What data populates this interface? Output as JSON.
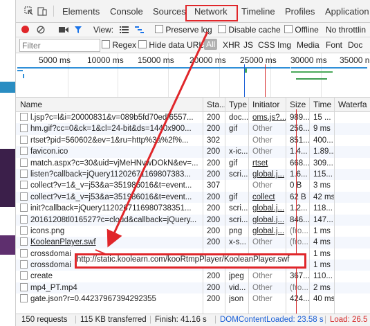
{
  "tabs": [
    "Elements",
    "Console",
    "Sources",
    "Network",
    "Timeline",
    "Profiles",
    "Application"
  ],
  "active_tab": "Network",
  "toolbar": {
    "view_label": "View:",
    "preserve_log": "Preserve log",
    "disable_cache": "Disable cache",
    "offline": "Offline",
    "throttling": "No throttlin"
  },
  "filter": {
    "placeholder": "Filter",
    "regex": "Regex",
    "hide_data_urls": "Hide data URLs",
    "types": [
      "All",
      "XHR",
      "JS",
      "CSS",
      "Img",
      "Media",
      "Font",
      "Doc"
    ]
  },
  "overview_ticks": [
    "5000 ms",
    "10000 ms",
    "15000 ms",
    "20000 ms",
    "25000 ms",
    "30000 ms",
    "35000 n"
  ],
  "columns": [
    "Name",
    "Sta...",
    "Type",
    "Initiator",
    "Size",
    "Time",
    "Waterfa"
  ],
  "rows": [
    {
      "name": "l.jsp?c=l&i=20000831&v=089b5fd70edf6557...",
      "status": "200",
      "type": "doc...",
      "initiator": "oms.js?...",
      "size": "989...",
      "time": "15 ..."
    },
    {
      "name": "hm.gif?cc=0&ck=1&cl=24-bit&ds=1440x900...",
      "status": "200",
      "type": "gif",
      "initiator": "Other",
      "size": "256...",
      "time": "9 ms"
    },
    {
      "name": "rtset?pid=560602&ev=1&ru=http%3a%2f%...",
      "status": "302",
      "type": "",
      "initiator": "Other",
      "size": "851...",
      "time": "400..."
    },
    {
      "name": "favicon.ico",
      "status": "200",
      "type": "x-ic...",
      "initiator": "Other",
      "size": "1.4...",
      "time": "1.89..."
    },
    {
      "name": "match.aspx?c=30&uid=vjMeHNvwDOkN&ev=...",
      "status": "200",
      "type": "gif",
      "initiator": "rtset",
      "size": "668...",
      "time": "309..."
    },
    {
      "name": "listen?callback=jQuery11202671169807383...",
      "status": "200",
      "type": "scri...",
      "initiator": "global.j...",
      "size": "1.6...",
      "time": "115..."
    },
    {
      "name": "collect?v=1&_v=j53&a=351986016&t=event...",
      "status": "307",
      "type": "",
      "initiator": "Other",
      "size": "0 B",
      "time": "3 ms"
    },
    {
      "name": "collect?v=1&_v=j53&a=351986016&t=event...",
      "status": "200",
      "type": "gif",
      "initiator": "collect",
      "size": "62 B",
      "time": "42 ms"
    },
    {
      "name": "init?callback=jQuery1120267116980738351...",
      "status": "200",
      "type": "scri...",
      "initiator": "global.j...",
      "size": "1.2...",
      "time": "118..."
    },
    {
      "name": "20161208tl016527?c=cloud&callback=jQuery...",
      "status": "200",
      "type": "scri...",
      "initiator": "global.j...",
      "size": "846...",
      "time": "147..."
    },
    {
      "name": "icons.png",
      "status": "200",
      "type": "png",
      "initiator": "global.j...",
      "size": "(fro...",
      "time": "1 ms"
    },
    {
      "name": "KooleanPlayer.swf",
      "status": "200",
      "type": "x-s...",
      "initiator": "Other",
      "size": "(fro...",
      "time": "4 ms"
    },
    {
      "name": "crossdomai",
      "status": "",
      "type": "",
      "initiator": "",
      "size": "",
      "time": "1 ms"
    },
    {
      "name": "crossdomai",
      "status": "",
      "type": "",
      "initiator": "",
      "size": "",
      "time": "1 ms"
    },
    {
      "name": "create",
      "status": "200",
      "type": "jpeg",
      "initiator": "Other",
      "size": "367...",
      "time": "110..."
    },
    {
      "name": "mp4_PT.mp4",
      "status": "200",
      "type": "vid...",
      "initiator": "Other",
      "size": "(fro...",
      "time": "2 ms"
    },
    {
      "name": "gate.json?r=0.44237967394292355",
      "status": "200",
      "type": "json",
      "initiator": "Other",
      "size": "424...",
      "time": "40 ms"
    }
  ],
  "tooltip": "http://static.koolearn.com/kooRtmpPlayer/KooleanPlayer.swf",
  "status": {
    "requests": "150 requests",
    "transferred": "115 KB transferred",
    "finish": "Finish: 41.16 s",
    "dom": "DOMContentLoaded: 23.58 s",
    "load": "Load: 26.5"
  },
  "colors": {
    "accent_red": "#e0262a",
    "dom_blue": "#1a5fd6",
    "load_red": "#d52a2a"
  }
}
